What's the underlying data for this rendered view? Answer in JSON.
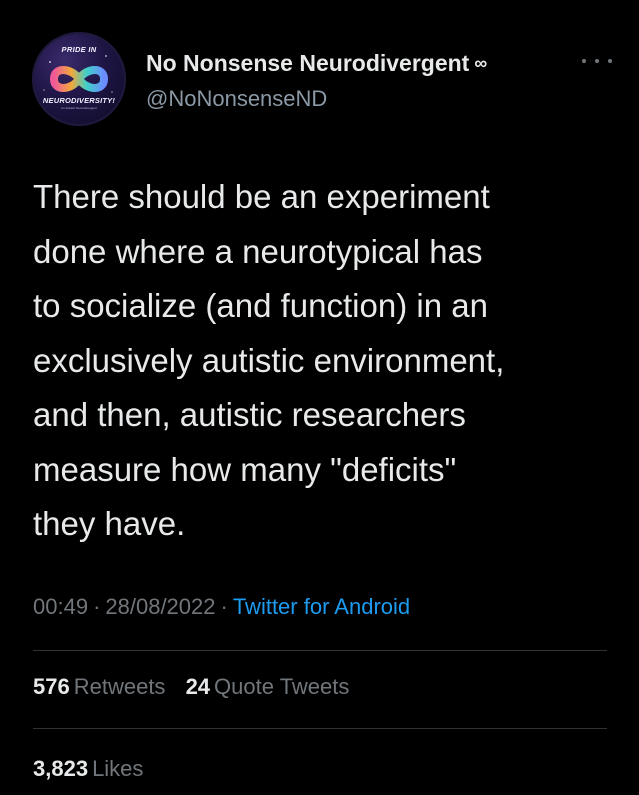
{
  "author": {
    "display_name": "No Nonsense Neurodivergent",
    "name_suffix": "∞",
    "handle": "@NoNonsenseND",
    "avatar": {
      "top_text": "PRIDE IN",
      "bottom_text": "NEURODIVERSITY!",
      "tiny_text": "for Autistic Neurodivergent"
    }
  },
  "tweet": {
    "text": "There should be an experiment\ndone where a neurotypical has\nto socialize (and function) in an\nexclusively autistic environment,\nand then, autistic researchers\nmeasure how many \"deficits\"\nthey have.",
    "time": "00:49",
    "date": "28/08/2022",
    "separator": "·",
    "source": "Twitter for Android"
  },
  "stats": {
    "retweets_count": "576",
    "retweets_label": "Retweets",
    "quotes_count": "24",
    "quotes_label": "Quote Tweets",
    "likes_count": "3,823",
    "likes_label": "Likes"
  },
  "colors": {
    "background": "#000000",
    "text": "#e7e9ea",
    "muted": "#71767b",
    "link": "#1d9bf0",
    "divider": "#2f3336"
  },
  "icons": {
    "more": "more-horizontal-icon",
    "infinity": "infinity-icon"
  }
}
